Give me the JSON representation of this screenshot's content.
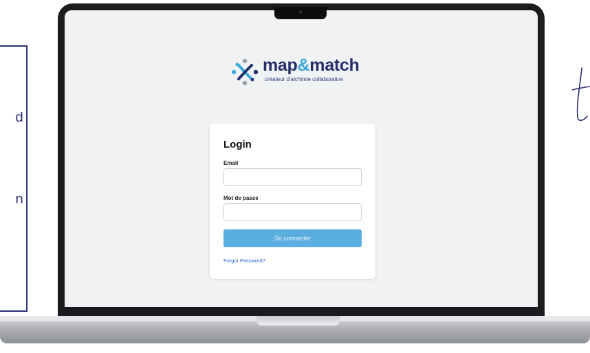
{
  "side_panel": {
    "letters": [
      "d",
      "n"
    ]
  },
  "brand": {
    "name_part1": "map",
    "name_amp": "&",
    "name_part2": "match",
    "tagline": "créateur d'alchimie collaborative",
    "colors": {
      "navy": "#23306b",
      "blue": "#3aa7de",
      "gray": "#9aa0a6"
    }
  },
  "login": {
    "title": "Login",
    "email_label": "Email",
    "email_value": "",
    "password_label": "Mot de passe",
    "password_value": "",
    "submit_label": "Se connecter",
    "forgot_label": "Forgot Password?",
    "colors": {
      "button": "#5aaee0",
      "link": "#2563c9"
    }
  }
}
